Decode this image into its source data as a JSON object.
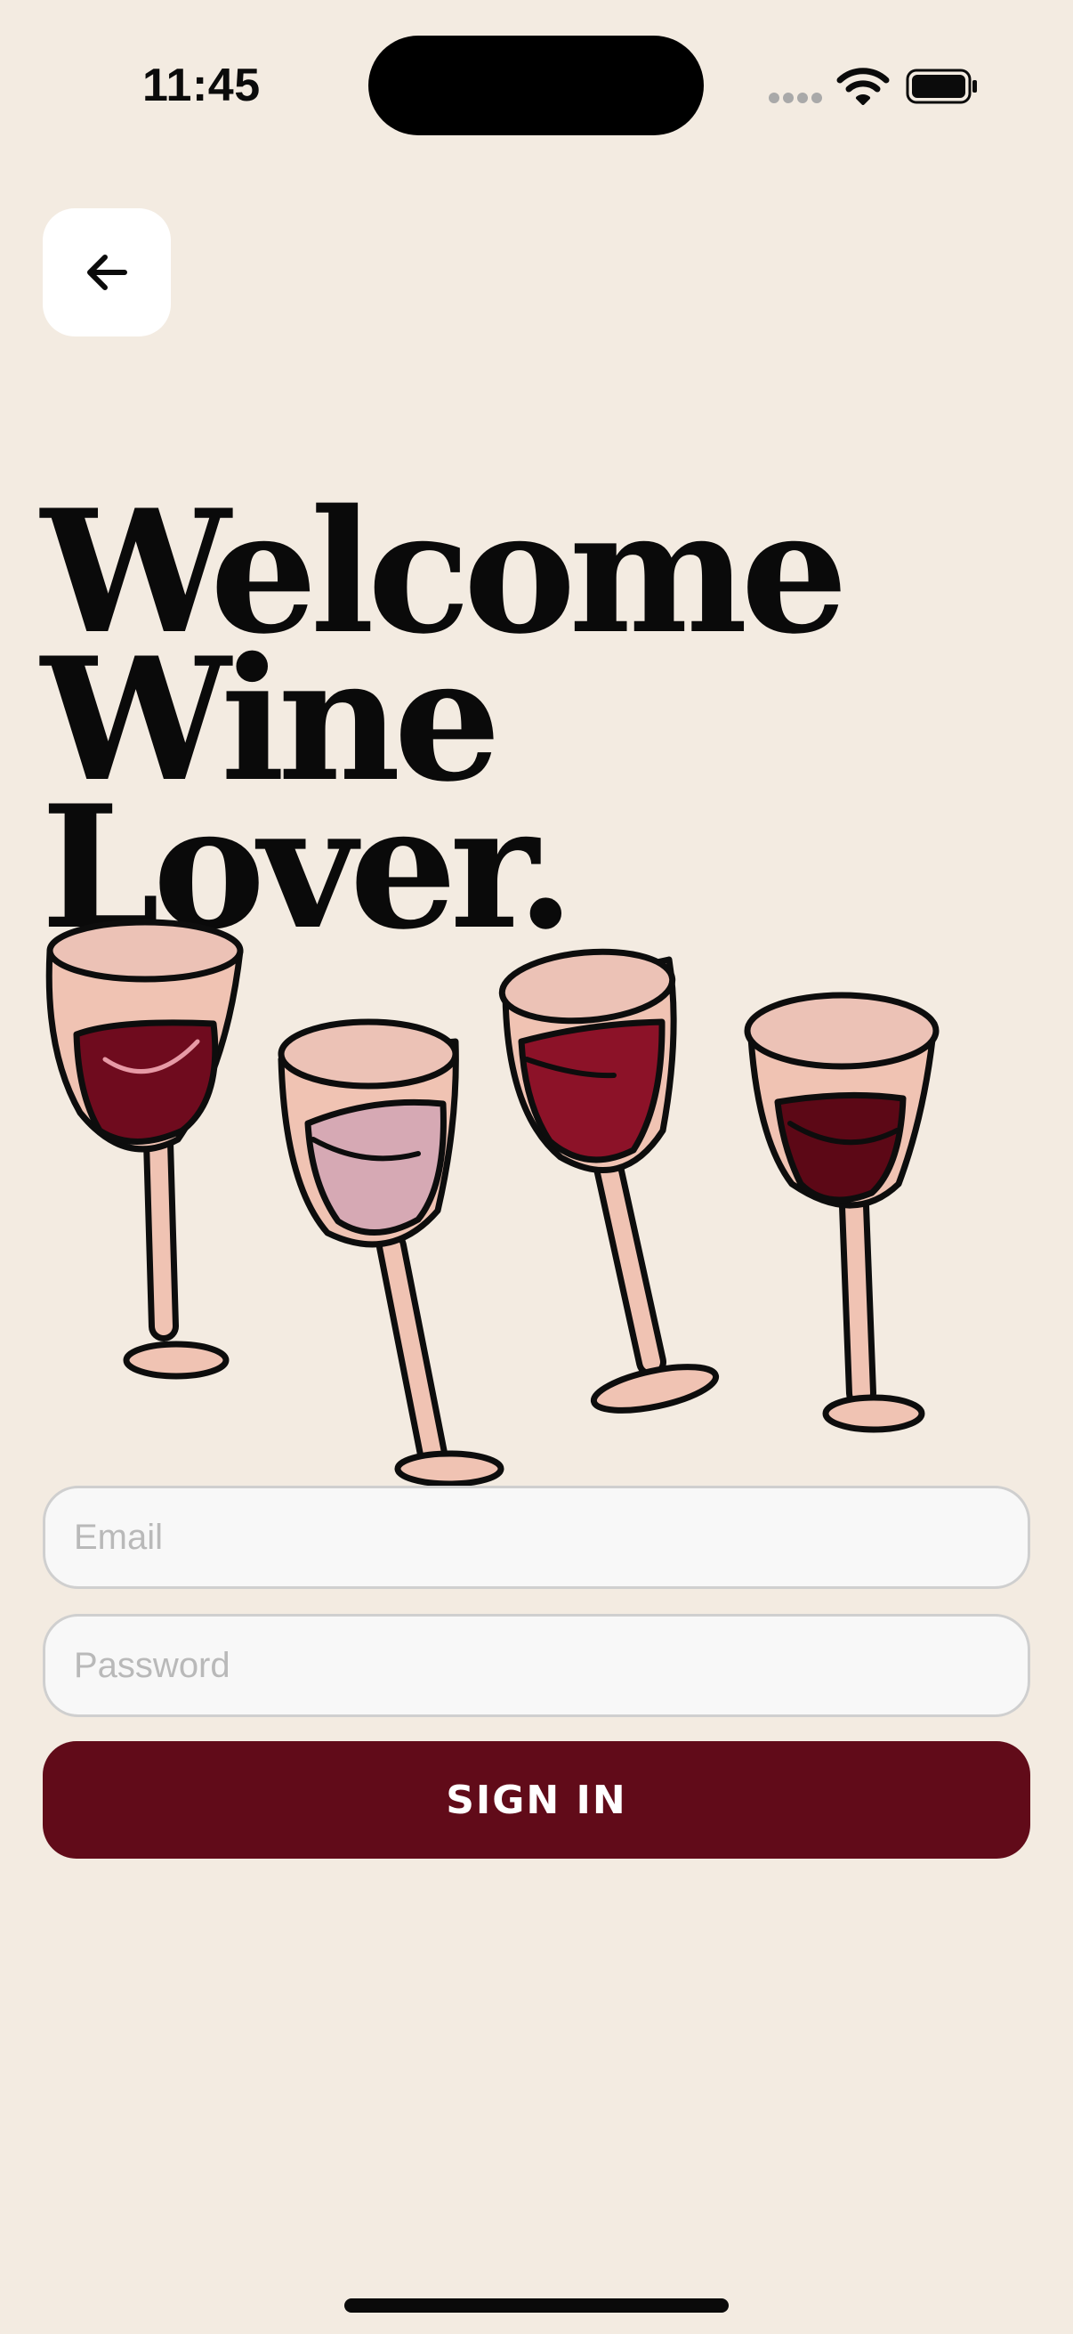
{
  "status_bar": {
    "time": "11:45",
    "icons": [
      "cellular-signal-icon",
      "wifi-icon",
      "battery-icon"
    ]
  },
  "header": {
    "back_icon": "arrow-left-icon"
  },
  "headline": {
    "line1": "Welcome",
    "line2": "Wine",
    "line3": "Lover."
  },
  "illustration": {
    "name": "wine-glasses-illustration",
    "wine_colors": [
      "#6f0b1e",
      "#d6a9b4",
      "#8c1228",
      "#5c0816"
    ],
    "glass_color": "#f0c3b3"
  },
  "form": {
    "email_placeholder": "Email",
    "email_value": "",
    "password_placeholder": "Password",
    "password_value": "",
    "submit_label": "SIGN IN"
  },
  "colors": {
    "background": "#f3ebe1",
    "primary": "#610b19",
    "field_bg": "#f8f8f8",
    "field_border": "#cfcfcf"
  }
}
